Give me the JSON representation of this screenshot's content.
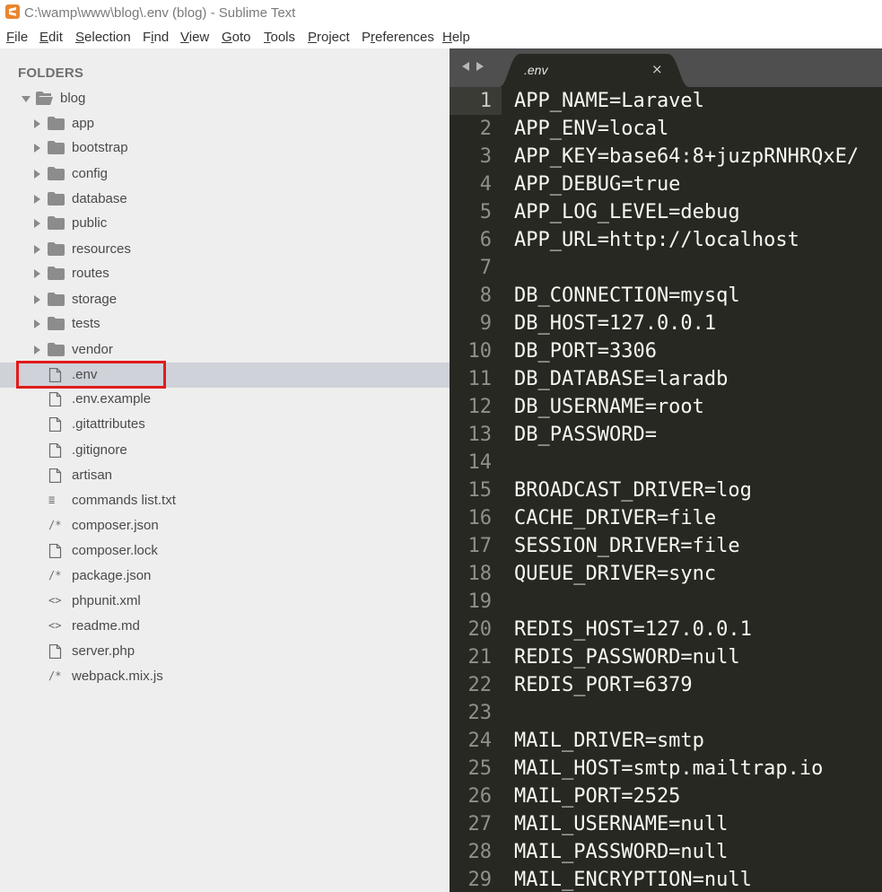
{
  "window": {
    "title": "C:\\wamp\\www\\blog\\.env (blog) - Sublime Text",
    "app_icon": "sublime-text-icon"
  },
  "menubar": {
    "items": [
      {
        "label": "File",
        "accel_index": 0
      },
      {
        "label": "Edit",
        "accel_index": 0
      },
      {
        "label": "Selection",
        "accel_index": 0
      },
      {
        "label": "Find",
        "accel_index": 1
      },
      {
        "label": "View",
        "accel_index": 0
      },
      {
        "label": "Goto",
        "accel_index": 0
      },
      {
        "label": "Tools",
        "accel_index": 0
      },
      {
        "label": "Project",
        "accel_index": 0
      },
      {
        "label": "Preferences",
        "accel_index": 1
      },
      {
        "label": "Help",
        "accel_index": 0
      }
    ]
  },
  "sidebar": {
    "header": "FOLDERS",
    "root": {
      "label": "blog",
      "expanded": true,
      "icon": "folder-open-icon"
    },
    "items": [
      {
        "label": "app",
        "kind": "folder",
        "icon": "folder-icon"
      },
      {
        "label": "bootstrap",
        "kind": "folder",
        "icon": "folder-icon"
      },
      {
        "label": "config",
        "kind": "folder",
        "icon": "folder-icon"
      },
      {
        "label": "database",
        "kind": "folder",
        "icon": "folder-icon"
      },
      {
        "label": "public",
        "kind": "folder",
        "icon": "folder-icon"
      },
      {
        "label": "resources",
        "kind": "folder",
        "icon": "folder-icon"
      },
      {
        "label": "routes",
        "kind": "folder",
        "icon": "folder-icon"
      },
      {
        "label": "storage",
        "kind": "folder",
        "icon": "folder-icon"
      },
      {
        "label": "tests",
        "kind": "folder",
        "icon": "folder-icon"
      },
      {
        "label": "vendor",
        "kind": "folder",
        "icon": "folder-icon"
      },
      {
        "label": ".env",
        "kind": "file",
        "icon": "file-icon",
        "selected": true,
        "highlighted": true
      },
      {
        "label": ".env.example",
        "kind": "file",
        "icon": "file-icon"
      },
      {
        "label": ".gitattributes",
        "kind": "file",
        "icon": "file-icon"
      },
      {
        "label": ".gitignore",
        "kind": "file",
        "icon": "file-icon"
      },
      {
        "label": "artisan",
        "kind": "file",
        "icon": "file-icon"
      },
      {
        "label": "commands list.txt",
        "kind": "file",
        "icon": "text-file-icon",
        "glyph": "≣"
      },
      {
        "label": "composer.json",
        "kind": "file",
        "icon": "json-file-icon",
        "glyph": "/*"
      },
      {
        "label": "composer.lock",
        "kind": "file",
        "icon": "file-icon"
      },
      {
        "label": "package.json",
        "kind": "file",
        "icon": "json-file-icon",
        "glyph": "/*"
      },
      {
        "label": "phpunit.xml",
        "kind": "file",
        "icon": "markup-file-icon",
        "glyph": "<>"
      },
      {
        "label": "readme.md",
        "kind": "file",
        "icon": "markup-file-icon",
        "glyph": "<>"
      },
      {
        "label": "server.php",
        "kind": "file",
        "icon": "file-icon"
      },
      {
        "label": "webpack.mix.js",
        "kind": "file",
        "icon": "json-file-icon",
        "glyph": "/*"
      }
    ]
  },
  "editor": {
    "tab": {
      "label": ".env",
      "close_glyph": "×"
    },
    "current_line": 1,
    "lines": [
      "APP_NAME=Laravel",
      "APP_ENV=local",
      "APP_KEY=base64:8+juzpRNHRQxE/",
      "APP_DEBUG=true",
      "APP_LOG_LEVEL=debug",
      "APP_URL=http://localhost",
      "",
      "DB_CONNECTION=mysql",
      "DB_HOST=127.0.0.1",
      "DB_PORT=3306",
      "DB_DATABASE=laradb",
      "DB_USERNAME=root",
      "DB_PASSWORD=",
      "",
      "BROADCAST_DRIVER=log",
      "CACHE_DRIVER=file",
      "SESSION_DRIVER=file",
      "QUEUE_DRIVER=sync",
      "",
      "REDIS_HOST=127.0.0.1",
      "REDIS_PASSWORD=null",
      "REDIS_PORT=6379",
      "",
      "MAIL_DRIVER=smtp",
      "MAIL_HOST=smtp.mailtrap.io",
      "MAIL_PORT=2525",
      "MAIL_USERNAME=null",
      "MAIL_PASSWORD=null",
      "MAIL_ENCRYPTION=null"
    ]
  },
  "colors": {
    "editor_bg": "#272822",
    "sidebar_bg": "#eeeeee",
    "selection_bg": "#cfd2d9",
    "highlight_border": "#e11b1b",
    "tabbar_bg": "#4f4f4f"
  }
}
